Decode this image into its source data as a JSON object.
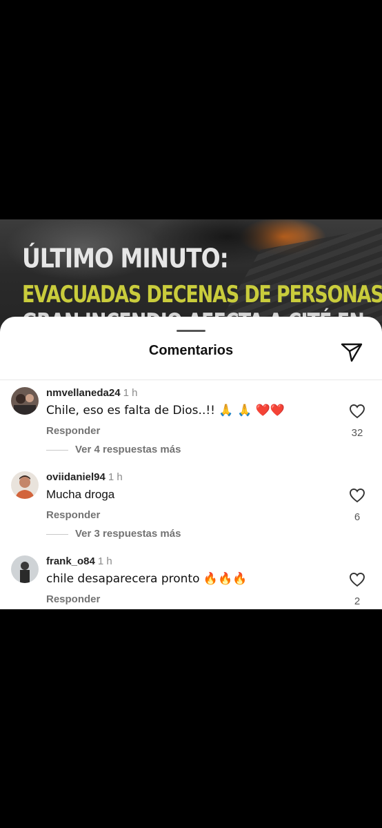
{
  "video": {
    "headline_line1": "ÚLTIMO MINUTO:",
    "headline_line2": "EVACUADAS DECENAS DE PERSONAS",
    "headline_line3": "GRAN INCENDIO AFECTA A CITÉ EN"
  },
  "sheet": {
    "title": "Comentarios",
    "share_icon": "paper-plane-icon"
  },
  "comments": [
    {
      "username": "nmvellaneda24",
      "time": "1 h",
      "text": "Chile, eso es falta de Dios..!! 🙏 🙏 ❤️❤️",
      "reply_label": "Responder",
      "view_replies": "Ver 4 respuestas más",
      "likes": "32"
    },
    {
      "username": "oviidaniel94",
      "time": "1 h",
      "text": "Mucha droga",
      "reply_label": "Responder",
      "view_replies": "Ver 3 respuestas más",
      "likes": "6"
    },
    {
      "username": "frank_o84",
      "time": "1 h",
      "text": "chile desaparecera pronto 🔥🔥🔥",
      "reply_label": "Responder",
      "view_replies": "",
      "likes": "2"
    }
  ],
  "colors": {
    "headline_accent": "#c9cc3c",
    "muted_text": "#737373"
  }
}
